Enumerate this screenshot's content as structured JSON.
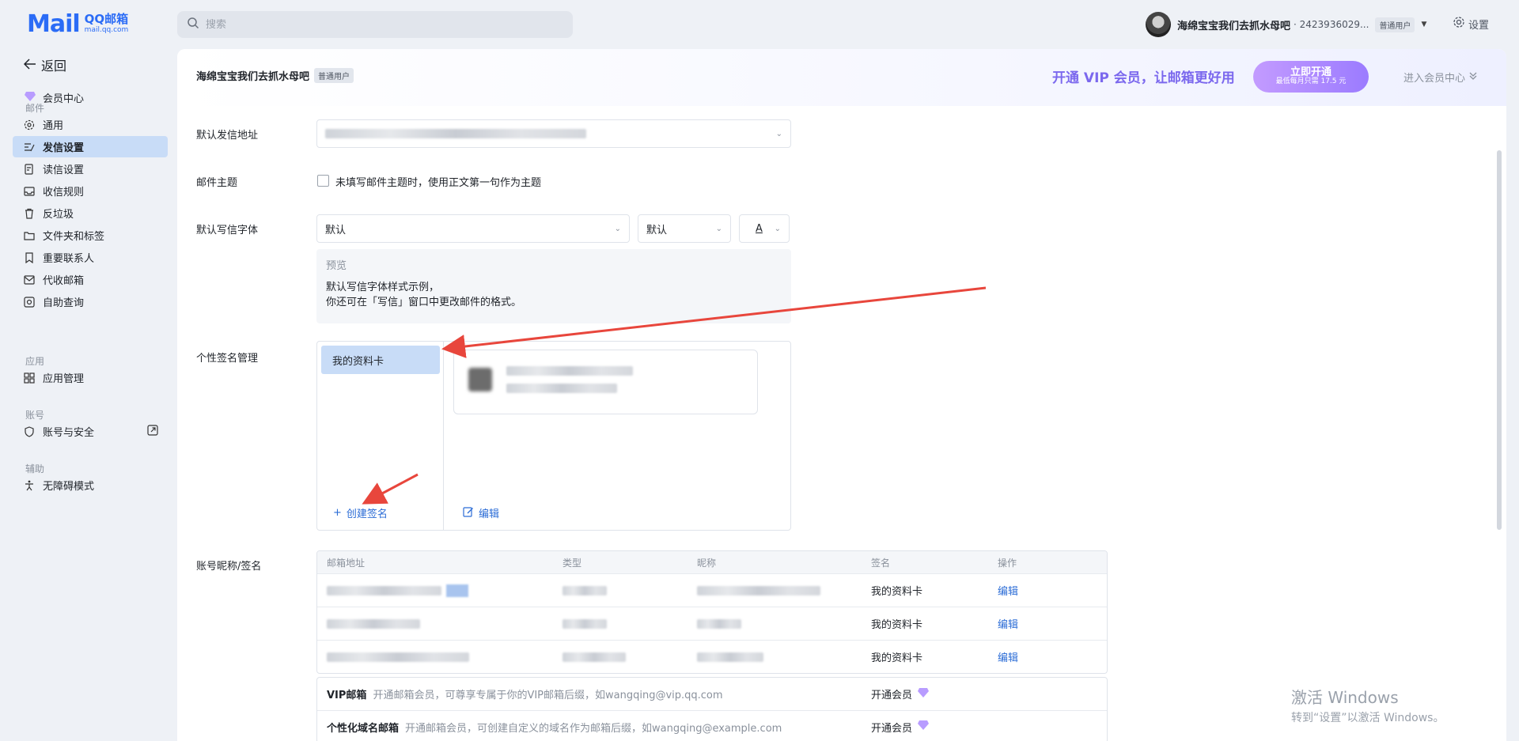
{
  "brand": {
    "logo_main": "Mail",
    "logo_sub_a": "QQ邮箱",
    "logo_sub_b": "mail.qq.com"
  },
  "search": {
    "placeholder": "搜索"
  },
  "user": {
    "name": "海绵宝宝我们去抓水母吧",
    "id": "· 2423936029...",
    "badge": "普通用户"
  },
  "top": {
    "settings_label": "设置"
  },
  "sidebar": {
    "back_label": "返回",
    "member_center": "会员中心",
    "sections": {
      "mail": "邮件",
      "apps": "应用",
      "account": "账号",
      "assist": "辅助"
    },
    "items": {
      "general": "通用",
      "send": "发信设置",
      "read": "读信设置",
      "rules": "收信规则",
      "spam": "反垃圾",
      "folders": "文件夹和标签",
      "contacts": "重要联系人",
      "proxy": "代收邮箱",
      "self_query": "自助查询",
      "app_manage": "应用管理",
      "security": "账号与安全",
      "accessibility": "无障碍模式"
    }
  },
  "banner": {
    "user_name": "海绵宝宝我们去抓水母吧",
    "user_badge": "普通用户",
    "promo": "开通 VIP 会员，让邮箱更好用",
    "btn_main": "立即开通",
    "btn_sub": "最低每月只需 17.5 元",
    "center_link": "进入会员中心"
  },
  "form": {
    "default_sender_label": "默认发信地址",
    "subject_label": "邮件主题",
    "subject_checkbox": "未填写邮件主题时，使用正文第一句作为主题",
    "font_label": "默认写信字体",
    "font_family_value": "默认",
    "font_size_value": "默认",
    "font_color_glyph": "A",
    "preview_title": "预览",
    "preview_line1": "默认写信字体样式示例，",
    "preview_line2": "你还可在「写信」窗口中更改邮件的格式。",
    "signature_label": "个性签名管理",
    "signature_item": "我的资料卡",
    "create_signature": "创建签名",
    "edit": "编辑",
    "nickname_label": "账号昵称/签名"
  },
  "accounts": {
    "headers": [
      "邮箱地址",
      "类型",
      "昵称",
      "签名",
      "操作"
    ],
    "rows": [
      {
        "signature": "我的资料卡",
        "action": "编辑"
      },
      {
        "signature": "我的资料卡",
        "action": "编辑"
      },
      {
        "signature": "我的资料卡",
        "action": "编辑"
      }
    ]
  },
  "vip_rows": [
    {
      "title": "VIP邮箱",
      "desc": "开通邮箱会员，可尊享专属于你的VIP邮箱后缀，如wangqing@vip.qq.com",
      "action": "开通会员"
    },
    {
      "title": "个性化域名邮箱",
      "desc": "开通邮箱会员，可创建自定义的域名作为邮箱后缀，如wangqing@example.com",
      "action": "开通会员"
    }
  ],
  "watermark": {
    "line1": "激活 Windows",
    "line2": "转到“设置”以激活 Windows。"
  },
  "colors": {
    "accent": "#2b6cd6",
    "active_bg": "#c8dcf7",
    "vip_purple": "#7b68ee",
    "annotation_red": "#e8463c"
  }
}
